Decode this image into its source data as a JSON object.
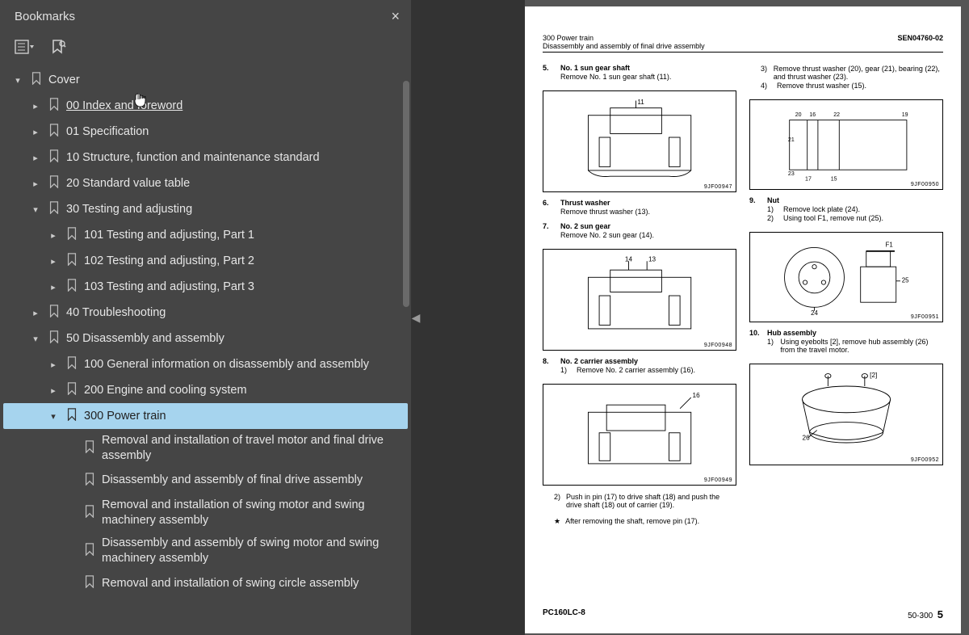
{
  "sidebar": {
    "title": "Bookmarks",
    "tree": [
      {
        "indent": 0,
        "chev": "down",
        "label": "Cover",
        "underline": false
      },
      {
        "indent": 1,
        "chev": "right",
        "label": "00 Index and foreword",
        "underline": true
      },
      {
        "indent": 1,
        "chev": "right",
        "label": "01 Specification"
      },
      {
        "indent": 1,
        "chev": "right",
        "label": "10 Structure, function and maintenance standard"
      },
      {
        "indent": 1,
        "chev": "right",
        "label": "20 Standard value table"
      },
      {
        "indent": 1,
        "chev": "down",
        "label": "30 Testing and adjusting"
      },
      {
        "indent": 2,
        "chev": "right",
        "label": "101 Testing and adjusting, Part 1"
      },
      {
        "indent": 2,
        "chev": "right",
        "label": "102 Testing and adjusting, Part 2"
      },
      {
        "indent": 2,
        "chev": "right",
        "label": "103 Testing and adjusting, Part 3"
      },
      {
        "indent": 1,
        "chev": "right",
        "label": "40 Troubleshooting"
      },
      {
        "indent": 1,
        "chev": "down",
        "label": "50 Disassembly and assembly"
      },
      {
        "indent": 2,
        "chev": "right",
        "label": "100 General information on disassembly and assembly"
      },
      {
        "indent": 2,
        "chev": "right",
        "label": "200 Engine and cooling system"
      },
      {
        "indent": 2,
        "chev": "down",
        "label": "300 Power train",
        "selected": true
      },
      {
        "indent": 3,
        "chev": "",
        "label": "Removal and installation of travel motor and final drive assembly"
      },
      {
        "indent": 3,
        "chev": "",
        "label": "Disassembly and assembly of final drive assembly"
      },
      {
        "indent": 3,
        "chev": "",
        "label": "Removal and installation of swing motor and swing machinery assembly"
      },
      {
        "indent": 3,
        "chev": "",
        "label": "Disassembly and assembly of swing motor and swing machinery assembly"
      },
      {
        "indent": 3,
        "chev": "",
        "label": "Removal and installation of swing circle assembly"
      }
    ]
  },
  "document": {
    "header": {
      "section": "300 Power train",
      "subsection": "Disassembly and assembly of final drive assembly",
      "docnum": "SEN04760-02"
    },
    "left_col": [
      {
        "n": "5.",
        "title": "No. 1 sun gear shaft",
        "desc": "Remove No. 1 sun gear shaft (11).",
        "fig": "9JF00947"
      },
      {
        "n": "6.",
        "title": "Thrust washer",
        "desc": "Remove thrust washer (13)."
      },
      {
        "n": "7.",
        "title": "No. 2 sun gear",
        "desc": "Remove No. 2 sun gear (14).",
        "fig": "9JF00948"
      },
      {
        "n": "8.",
        "title": "No. 2 carrier assembly",
        "subs": [
          {
            "k": "1)",
            "t": "Remove No. 2 carrier assembly (16)."
          }
        ],
        "fig": "9JF00949",
        "post_subs": [
          {
            "k": "2)",
            "t": "Push in pin (17) to drive shaft (18) and push the drive shaft (18) out of carrier (19)."
          }
        ],
        "star": "After removing the shaft, remove pin (17)."
      }
    ],
    "right_col": [
      {
        "cont": true,
        "subs": [
          {
            "k": "3)",
            "t": "Remove thrust washer (20), gear (21), bearing (22), and thrust washer (23)."
          },
          {
            "k": "4)",
            "t": "Remove thrust washer (15)."
          }
        ],
        "fig": "9JF00950"
      },
      {
        "n": "9.",
        "title": "Nut",
        "subs": [
          {
            "k": "1)",
            "t": "Remove lock plate (24)."
          },
          {
            "k": "2)",
            "t": "Using tool F1, remove nut (25)."
          }
        ],
        "fig": "9JF00951"
      },
      {
        "n": "10.",
        "title": "Hub assembly",
        "subs": [
          {
            "k": "1)",
            "t": "Using eyebolts [2], remove hub assembly (26) from the travel motor."
          }
        ],
        "fig": "9JF00952"
      }
    ],
    "footer": {
      "model": "PC160LC-8",
      "page": "50-300",
      "num": "5"
    }
  }
}
